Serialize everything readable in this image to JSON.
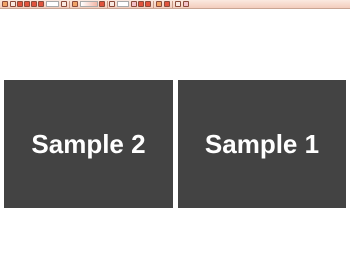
{
  "toolbar": {
    "zoom_value": "",
    "layout_select": "",
    "tools": [
      "toolbar-tool-icon",
      "open-file-icon",
      "first-page-icon",
      "previous-page-icon",
      "next-page-icon",
      "last-page-icon",
      "page-number-field",
      "zoom-out-icon",
      "zoom-slider",
      "zoom-in-icon",
      "view-mode-select",
      "thumbnail-icon",
      "single-page-icon",
      "two-page-icon",
      "fit-width-icon",
      "fit-page-icon",
      "settings-icon",
      "info-icon"
    ]
  },
  "slides": [
    {
      "title": "Sample 2"
    },
    {
      "title": "Sample 1"
    }
  ],
  "colors": {
    "slide_background": "#434343",
    "slide_text": "#ffffff",
    "page_background": "#ffffff",
    "toolbar_top": "#fbe9e0",
    "toolbar_bottom": "#f3cdbd"
  }
}
